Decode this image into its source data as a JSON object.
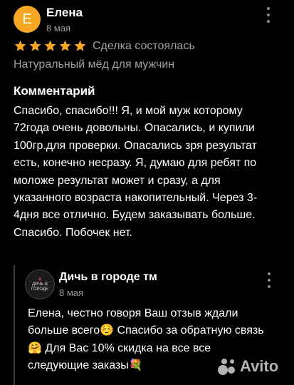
{
  "review": {
    "avatar_letter": "Е",
    "author_name": "Елена",
    "date": "8 мая",
    "rating": 5,
    "deal_status": "Сделка состоялась",
    "product_title": "Натуральный мёд для мужчин",
    "comment_heading": "Комментарий",
    "comment_text": "Спасибо, спасибо!!! Я, и мой муж которому 72года очень довольны. Опасались, и купили 100гр.для проверки. Опасались зря результат есть, конечно несразу. Я, думаю для ребят по моложе результат может и сразу, а для указанного возраста накопительный. Через 3-4дня все отлично. Будем заказывать больше. Спасибо. Побочек нет."
  },
  "reply": {
    "seller_avatar_text": "ДИЧЬ В ГОРОДЕ",
    "seller_name": "Дичь в городе тм",
    "date": "8 мая",
    "text": "Елена, честно говоря Ваш отзыв ждали больше всего☺️ Спасибо за обратную связь🤗 Для Вас 10% скидка на все все следующие заказы💐"
  },
  "watermark": {
    "text": "Avito"
  },
  "colors": {
    "star": "#f5a623",
    "avatar": "#f5a623",
    "background": "#000000",
    "secondary_text": "#a0a0a0"
  },
  "icons": [
    "more-vertical-icon",
    "star-icon",
    "avito-logo-icon"
  ]
}
